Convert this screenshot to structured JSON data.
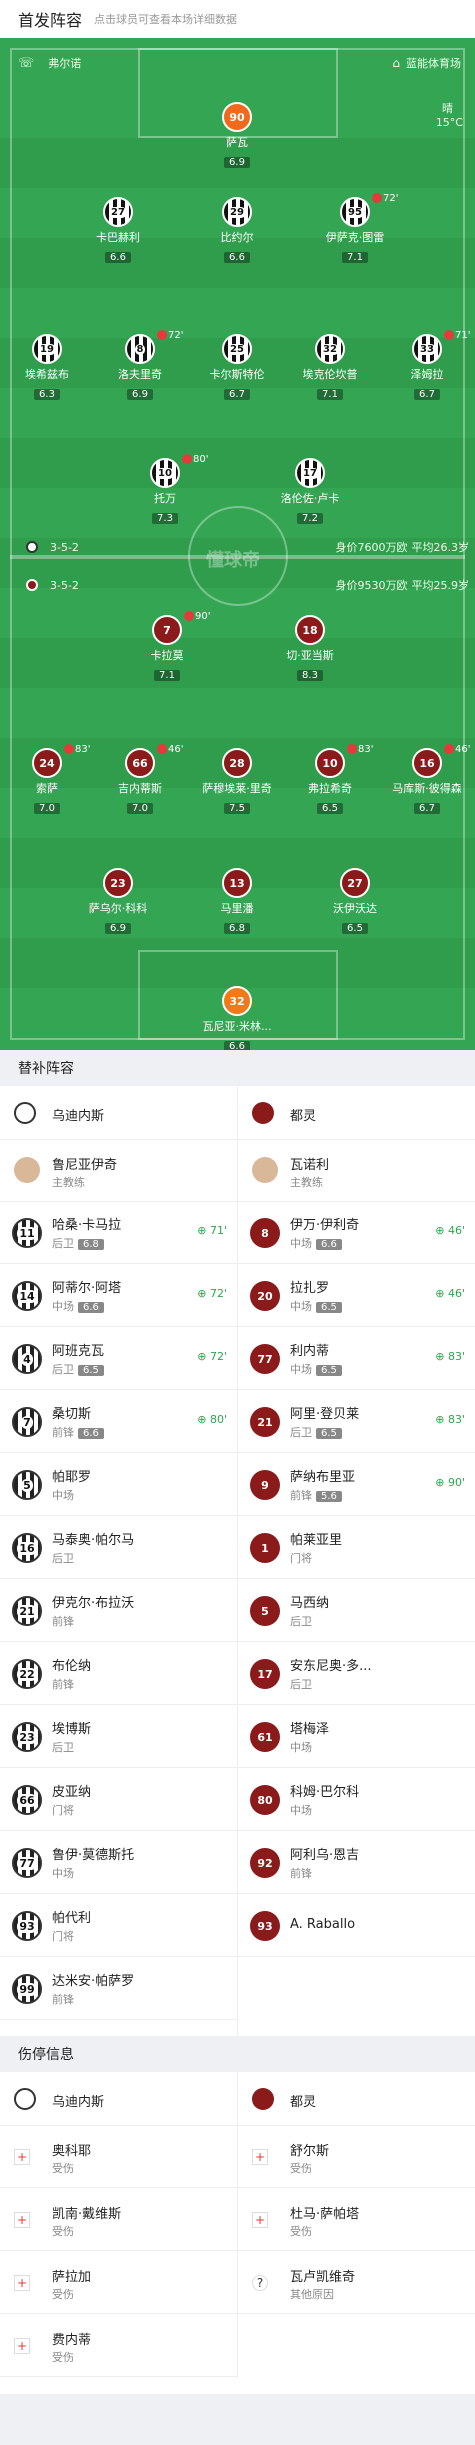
{
  "header": {
    "title": "首发阵容",
    "hint": "点击球员可查看本场详细数据"
  },
  "venue": {
    "home_team": "弗尔诺",
    "stadium": "蓝能体育场",
    "weather": "晴",
    "temp": "15°C"
  },
  "home": {
    "formation": "3-5-2",
    "value": "身价7600万欧",
    "age": "平均26.3岁"
  },
  "away": {
    "formation": "3-5-2",
    "value": "身价9530万欧",
    "age": "平均25.9岁"
  },
  "watermark": "懂球帝",
  "pitch_home": [
    {
      "num": "90",
      "name": "萨瓦",
      "rating": "6.9",
      "gk": true
    },
    {
      "num": "27",
      "name": "卡巴赫利",
      "rating": "6.6"
    },
    {
      "num": "29",
      "name": "比约尔",
      "rating": "6.6"
    },
    {
      "num": "95",
      "name": "伊萨克·图雷",
      "rating": "7.1",
      "sub": "72'"
    },
    {
      "num": "19",
      "name": "埃希兹布",
      "rating": "6.3"
    },
    {
      "num": "8",
      "name": "洛夫里奇",
      "rating": "6.9",
      "sub": "72'"
    },
    {
      "num": "25",
      "name": "卡尔斯特伦",
      "rating": "6.7"
    },
    {
      "num": "32",
      "name": "埃克伦坎普",
      "rating": "7.1"
    },
    {
      "num": "33",
      "name": "泽姆拉",
      "rating": "6.7",
      "sub": "71'"
    },
    {
      "num": "10",
      "name": "托万",
      "rating": "7.3",
      "sub": "80'"
    },
    {
      "num": "17",
      "name": "洛伦佐·卢卡",
      "rating": "7.2"
    }
  ],
  "pitch_away": [
    {
      "num": "7",
      "name": "卡拉莫",
      "rating": "7.1",
      "sub": "90'"
    },
    {
      "num": "18",
      "name": "切·亚当斯",
      "rating": "8.3"
    },
    {
      "num": "24",
      "name": "索萨",
      "rating": "7.0",
      "sub": "83'"
    },
    {
      "num": "66",
      "name": "吉内蒂斯",
      "rating": "7.0",
      "sub": "46'"
    },
    {
      "num": "28",
      "name": "萨穆埃莱·里奇",
      "rating": "7.5"
    },
    {
      "num": "10",
      "name": "弗拉希奇",
      "rating": "6.5",
      "sub": "83'"
    },
    {
      "num": "16",
      "name": "马库斯·彼得森",
      "rating": "6.7",
      "sub": "46'"
    },
    {
      "num": "23",
      "name": "萨乌尔·科科",
      "rating": "6.9"
    },
    {
      "num": "13",
      "name": "马里潘",
      "rating": "6.8"
    },
    {
      "num": "27",
      "name": "沃伊沃达",
      "rating": "6.5"
    },
    {
      "num": "32",
      "name": "瓦尼亚·米林...",
      "rating": "6.6",
      "gk": true
    }
  ],
  "subs": {
    "title": "替补阵容",
    "home_team": "乌迪内斯",
    "away_team": "都灵",
    "home_coach": {
      "name": "鲁尼亚伊奇",
      "role": "主教练"
    },
    "away_coach": {
      "name": "瓦诺利",
      "role": "主教练"
    },
    "home": [
      {
        "num": "11",
        "name": "哈桑·卡马拉",
        "pos": "后卫",
        "rating": "6.8",
        "time": "71'"
      },
      {
        "num": "14",
        "name": "阿蒂尔·阿塔",
        "pos": "中场",
        "rating": "6.6",
        "time": "72'"
      },
      {
        "num": "4",
        "name": "阿班克瓦",
        "pos": "后卫",
        "rating": "6.5",
        "time": "72'"
      },
      {
        "num": "7",
        "name": "桑切斯",
        "pos": "前锋",
        "rating": "6.6",
        "time": "80'"
      },
      {
        "num": "5",
        "name": "帕耶罗",
        "pos": "中场"
      },
      {
        "num": "16",
        "name": "马泰奥·帕尔马",
        "pos": "后卫"
      },
      {
        "num": "21",
        "name": "伊克尔·布拉沃",
        "pos": "前锋"
      },
      {
        "num": "22",
        "name": "布伦纳",
        "pos": "前锋"
      },
      {
        "num": "23",
        "name": "埃博斯",
        "pos": "后卫"
      },
      {
        "num": "66",
        "name": "皮亚纳",
        "pos": "门将"
      },
      {
        "num": "77",
        "name": "鲁伊·莫德斯托",
        "pos": "中场"
      },
      {
        "num": "93",
        "name": "帕代利",
        "pos": "门将"
      },
      {
        "num": "99",
        "name": "达米安·帕萨罗",
        "pos": "前锋"
      }
    ],
    "away": [
      {
        "num": "8",
        "name": "伊万·伊利奇",
        "pos": "中场",
        "rating": "6.6",
        "time": "46'"
      },
      {
        "num": "20",
        "name": "拉扎罗",
        "pos": "中场",
        "rating": "6.5",
        "time": "46'"
      },
      {
        "num": "77",
        "name": "利内蒂",
        "pos": "中场",
        "rating": "6.5",
        "time": "83'"
      },
      {
        "num": "21",
        "name": "阿里·登贝莱",
        "pos": "后卫",
        "rating": "6.5",
        "time": "83'"
      },
      {
        "num": "9",
        "name": "萨纳布里亚",
        "pos": "前锋",
        "rating": "5.6",
        "time": "90'"
      },
      {
        "num": "1",
        "name": "帕莱亚里",
        "pos": "门将"
      },
      {
        "num": "5",
        "name": "马西纳",
        "pos": "后卫"
      },
      {
        "num": "17",
        "name": "安东尼奥·多...",
        "pos": "后卫"
      },
      {
        "num": "61",
        "name": "塔梅泽",
        "pos": "中场"
      },
      {
        "num": "80",
        "name": "科姆·巴尔科",
        "pos": "中场"
      },
      {
        "num": "92",
        "name": "阿利乌·恩吉",
        "pos": "前锋"
      },
      {
        "num": "93",
        "name": "A. Raballo",
        "pos": ""
      }
    ]
  },
  "injury": {
    "title": "伤停信息",
    "home_team": "乌迪内斯",
    "away_team": "都灵",
    "home": [
      {
        "name": "奥科耶",
        "reason": "受伤"
      },
      {
        "name": "凯南·戴维斯",
        "reason": "受伤"
      },
      {
        "name": "萨拉加",
        "reason": "受伤"
      },
      {
        "name": "费内蒂",
        "reason": "受伤"
      }
    ],
    "away": [
      {
        "name": "舒尔斯",
        "reason": "受伤"
      },
      {
        "name": "杜马·萨帕塔",
        "reason": "受伤"
      },
      {
        "name": "瓦卢凯维奇",
        "reason": "其他原因"
      }
    ]
  }
}
